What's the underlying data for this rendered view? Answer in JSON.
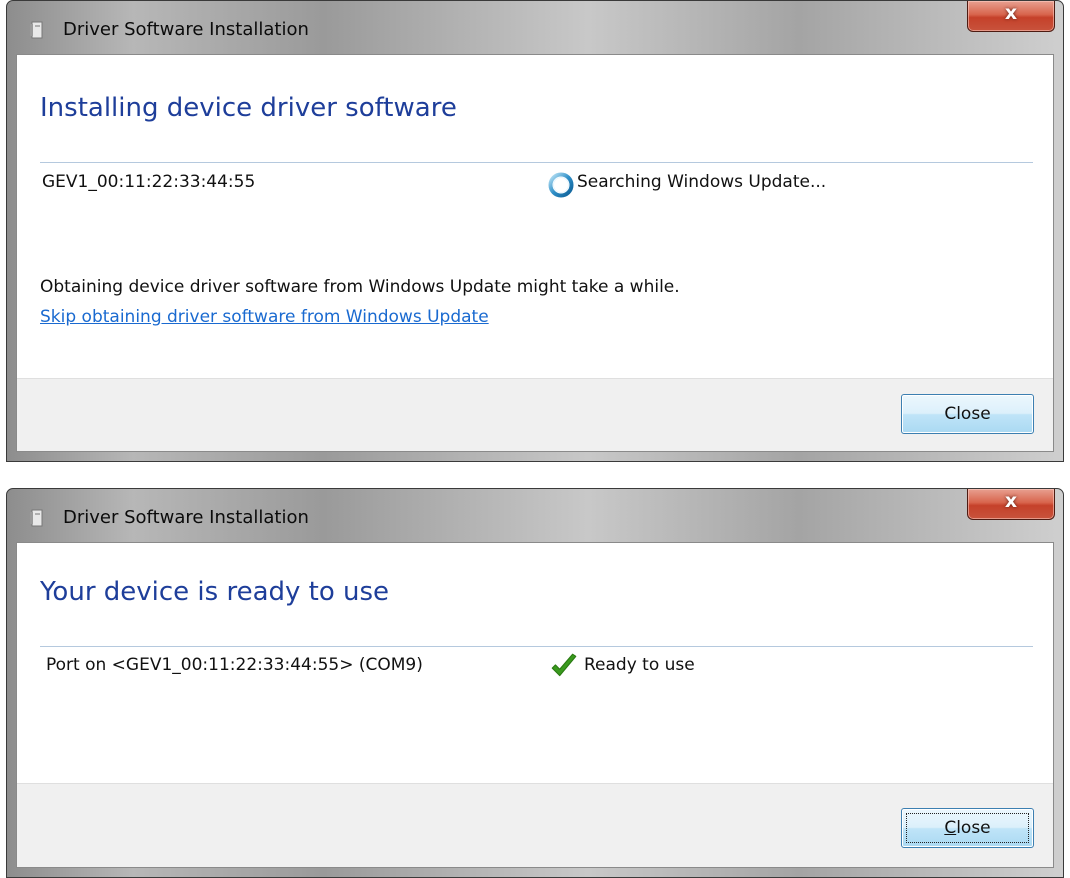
{
  "dialog1": {
    "title": "Driver Software Installation",
    "close_glyph": "x",
    "heading": "Installing device driver software",
    "device_name": "GEV1_00:11:22:33:44:55",
    "status_icon": "spinner-icon",
    "status_text": "Searching Windows Update...",
    "info_text": "Obtaining device driver software from Windows Update might take a while.",
    "skip_link": "Skip obtaining driver software from Windows Update",
    "close_button": "Close"
  },
  "dialog2": {
    "title": "Driver Software Installation",
    "close_glyph": "x",
    "heading": "Your device is ready to use",
    "device_name": "Port on <GEV1_00:11:22:33:44:55> (COM9)",
    "status_icon": "checkmark-icon",
    "status_text": "Ready to use",
    "close_button": "Close",
    "close_button_mnemonic": "C"
  },
  "colors": {
    "heading": "#1e3e9a",
    "link": "#1a6ad0",
    "checkmark": "#3a9a1e",
    "spinner": "#2f8fc8"
  }
}
